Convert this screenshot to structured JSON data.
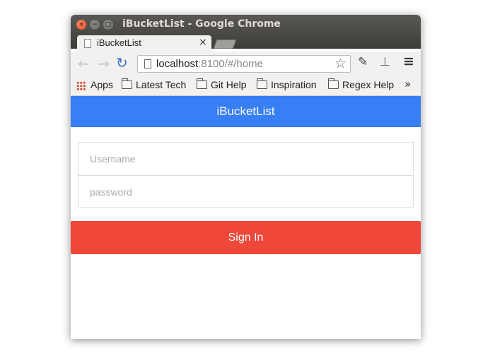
{
  "window": {
    "title": "iBucketList - Google Chrome",
    "controls": {
      "close": "×",
      "minimize": "−",
      "maximize": "□"
    }
  },
  "tab": {
    "label": "iBucketList",
    "close": "×"
  },
  "toolbar": {
    "url_host": "localhost",
    "url_rest": ":8100/#/home",
    "back": "←",
    "forward": "→",
    "reload": "↻",
    "star": "☆",
    "menu": "≡",
    "ext1": "✎",
    "ext2": "⊥"
  },
  "bookmarks": {
    "items": [
      {
        "label": "Apps",
        "icon": "apps-grid-icon"
      },
      {
        "label": "Latest Tech",
        "icon": "folder-icon"
      },
      {
        "label": "Git Help",
        "icon": "folder-icon"
      },
      {
        "label": "Inspiration",
        "icon": "folder-icon"
      },
      {
        "label": "Regex Help",
        "icon": "folder-icon"
      }
    ],
    "more": "»"
  },
  "app": {
    "header_title": "iBucketList",
    "username_placeholder": "Username",
    "password_placeholder": "password",
    "sign_in_label": "Sign In"
  },
  "colors": {
    "header": "#387ef5",
    "button": "#ef473a",
    "titlebar": "#3d3c38"
  }
}
